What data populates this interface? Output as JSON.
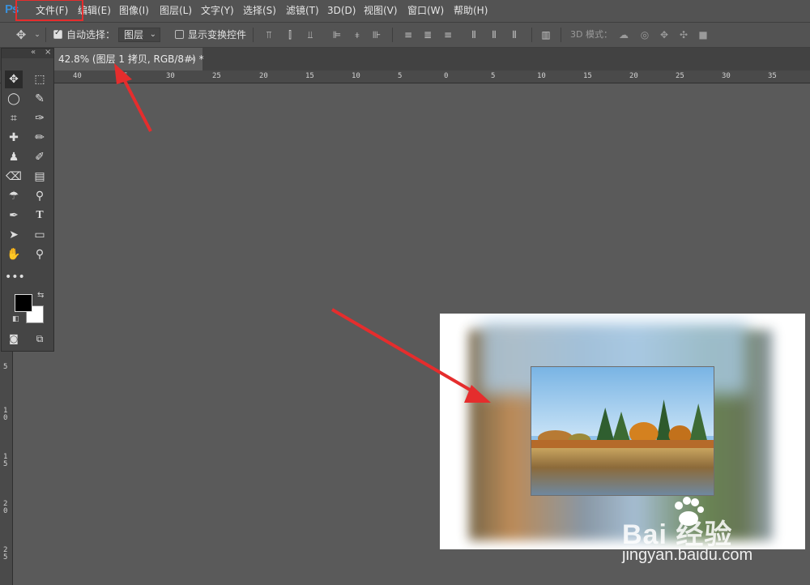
{
  "app": {
    "logo": "Ps"
  },
  "menu": [
    {
      "label": "文件(F)"
    },
    {
      "label": "编辑(E)"
    },
    {
      "label": "图像(I)"
    },
    {
      "label": "图层(L)"
    },
    {
      "label": "文字(Y)"
    },
    {
      "label": "选择(S)"
    },
    {
      "label": "滤镜(T)"
    },
    {
      "label": "3D(D)"
    },
    {
      "label": "视图(V)"
    },
    {
      "label": "窗口(W)"
    },
    {
      "label": "帮助(H)"
    }
  ],
  "options": {
    "auto_select_label": "自动选择：",
    "auto_select_checked": true,
    "auto_select_value": "图层",
    "show_transform_label": "显示变换控件",
    "show_transform_checked": false,
    "mode_3d_label": "3D 模式："
  },
  "document": {
    "tab_title": "42.8% (图层 1 拷贝, RGB/8#) *",
    "close": "×"
  },
  "ruler": {
    "h_labels": [
      "40",
      "35",
      "30",
      "25",
      "20",
      "15",
      "10",
      "5",
      "0",
      "5",
      "10",
      "15",
      "20",
      "25",
      "30",
      "35"
    ],
    "v_labels": [
      "5",
      "1\n0",
      "1\n5",
      "2\n0",
      "2\n5"
    ]
  },
  "toolbox": {
    "collapse": "«",
    "close": "×"
  },
  "colors": {
    "annotation_red": "#e52d2d",
    "foreground": "#000000",
    "background": "#ffffff",
    "ps_blue": "#3a8fd8"
  },
  "watermark": {
    "brand": "Bai  经验",
    "url": "jingyan.baidu.com"
  }
}
